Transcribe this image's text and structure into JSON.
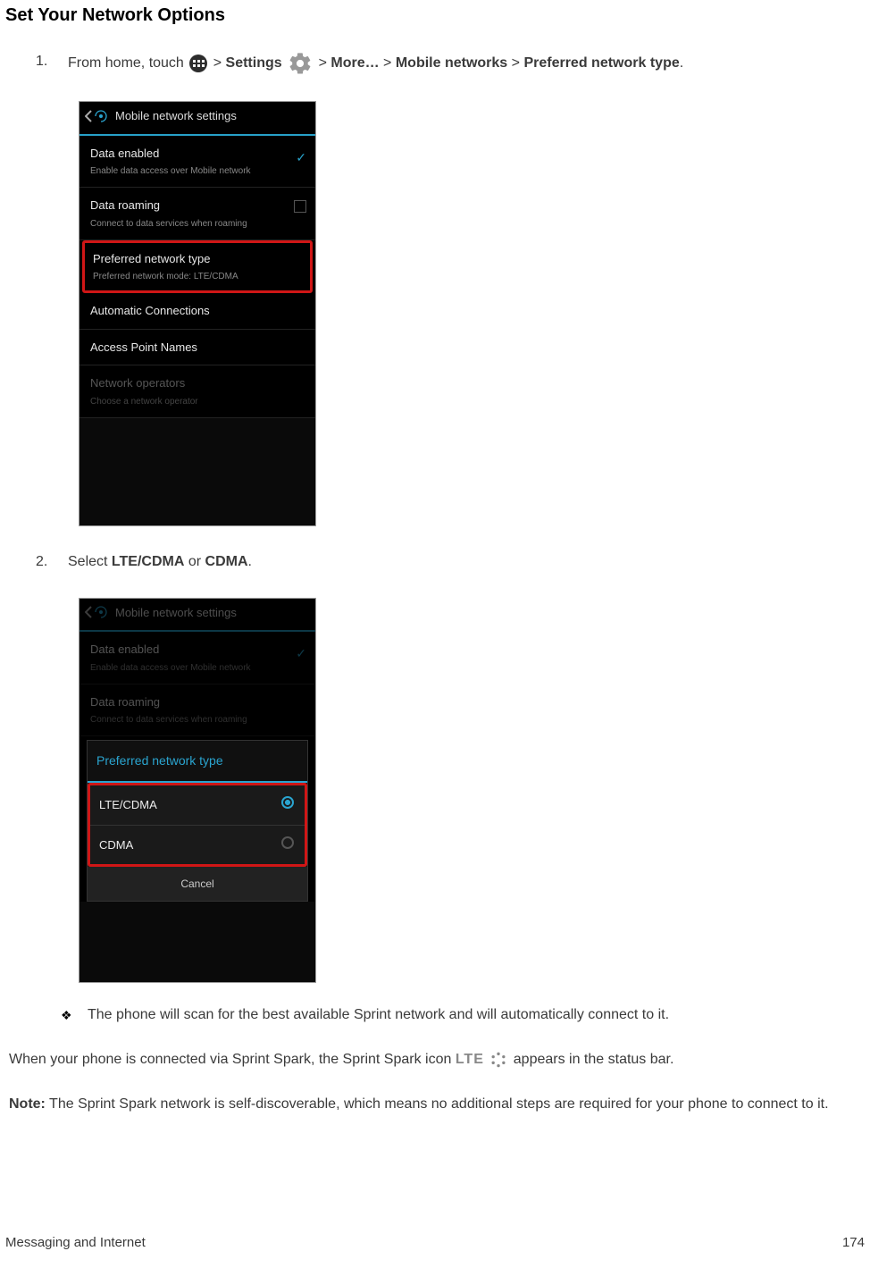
{
  "heading": "Set Your Network Options",
  "step1": {
    "num": "1.",
    "pre": "From home, touch ",
    "gt1": " > ",
    "settings": "Settings",
    "gt2": " > ",
    "more": "More…",
    "gt3": " > ",
    "mobile": "Mobile networks",
    "gt4": " > ",
    "pref": "Preferred network type",
    "dot": "."
  },
  "shot1": {
    "title": "Mobile network settings",
    "rows": {
      "data_enabled": {
        "t": "Data enabled",
        "s": "Enable data access over Mobile network"
      },
      "data_roaming": {
        "t": "Data roaming",
        "s": "Connect to data services when roaming"
      },
      "pref": {
        "t": "Preferred network type",
        "s": "Preferred network mode: LTE/CDMA"
      },
      "auto": {
        "t": "Automatic Connections"
      },
      "apn": {
        "t": "Access Point Names"
      },
      "netop": {
        "t": "Network operators",
        "s": "Choose a network operator"
      }
    }
  },
  "step2": {
    "num": "2.",
    "pre": "Select ",
    "a": "LTE/CDMA",
    "or": " or ",
    "b": "CDMA",
    "dot": "."
  },
  "shot2": {
    "title": "Mobile network settings",
    "dim": {
      "data_enabled": {
        "t": "Data enabled",
        "s": "Enable data access over Mobile network"
      },
      "data_roaming": {
        "t": "Data roaming",
        "s": "Connect to data services when roaming"
      }
    },
    "dialog_title": "Preferred network type",
    "opt1": "LTE/CDMA",
    "opt2": "CDMA",
    "cancel": "Cancel"
  },
  "bullet": "The phone will scan for the best available Sprint network and will automatically connect to it.",
  "para_pre": "When your phone is connected via Sprint Spark, the Sprint Spark icon ",
  "lte_text": "LTE",
  "para_post": " appears in the status bar.",
  "note_label": "Note:",
  "note_body": " The Sprint Spark network is self-discoverable, which means no additional steps are required for your phone to connect to it.",
  "footer_left": "Messaging and Internet",
  "footer_right": "174"
}
